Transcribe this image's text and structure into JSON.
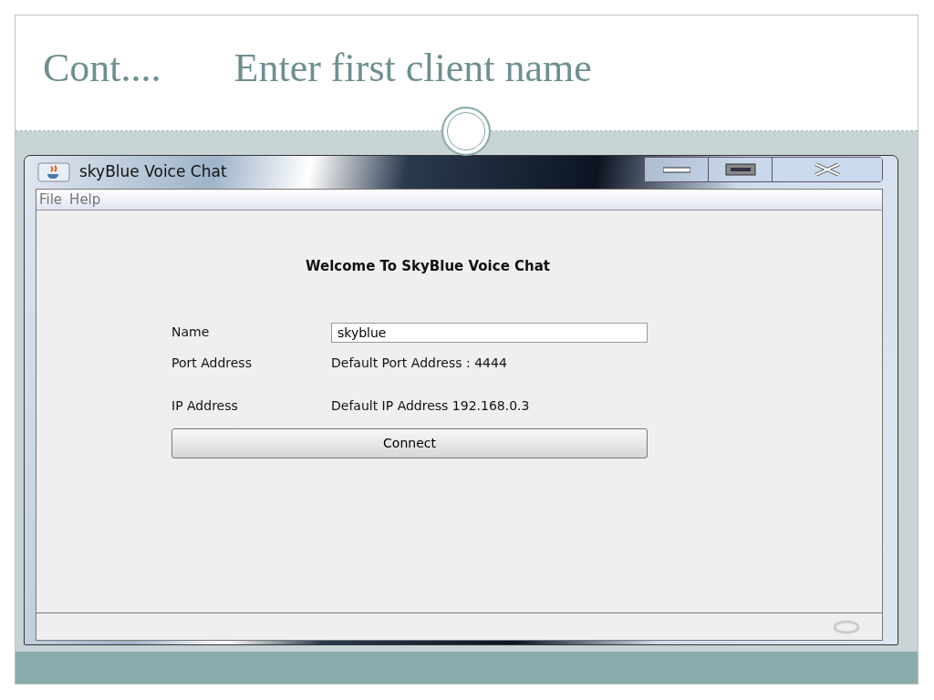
{
  "slide": {
    "title": "Cont....",
    "subtitle": "Enter first client name"
  },
  "window": {
    "title": "skyBlue Voice Chat"
  },
  "menu": [
    "File",
    "Help"
  ],
  "heading": "Welcome To SkyBlue Voice Chat",
  "form": [
    {
      "kind": "input",
      "label": "Name",
      "value": "skyblue"
    },
    {
      "kind": "text",
      "label": "Port Address",
      "value": "Default Port Address : 4444"
    },
    {
      "kind": "text",
      "label": "IP Address",
      "value": "Default IP Address 192.168.0.3"
    }
  ],
  "connect_button": "Connect"
}
